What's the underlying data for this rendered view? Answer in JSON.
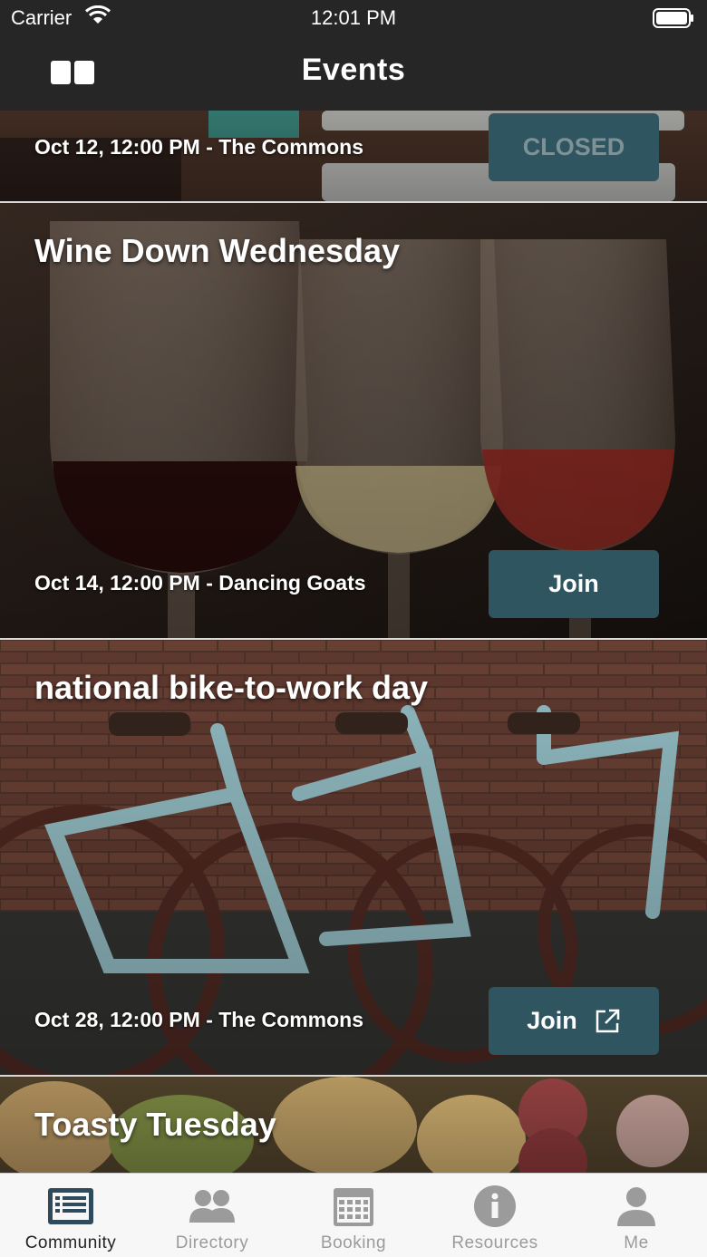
{
  "status_bar": {
    "carrier": "Carrier",
    "time": "12:01 PM"
  },
  "nav": {
    "title": "Events",
    "menu_icon": "book-icon"
  },
  "events": [
    {
      "title": "",
      "meta": "Oct 12, 12:00 PM - The Commons",
      "button": "CLOSED",
      "button_state": "closed"
    },
    {
      "title": "Wine Down Wednesday",
      "meta": "Oct 14, 12:00 PM - Dancing Goats",
      "button": "Join",
      "button_state": "open"
    },
    {
      "title": "national bike-to-work day",
      "meta": "Oct 28, 12:00 PM - The Commons",
      "button": "Join",
      "button_state": "external"
    },
    {
      "title": "Toasty Tuesday",
      "meta": "",
      "button": "",
      "button_state": ""
    }
  ],
  "tabs": [
    {
      "label": "Community",
      "icon": "news-list-icon",
      "active": true
    },
    {
      "label": "Directory",
      "icon": "people-icon",
      "active": false
    },
    {
      "label": "Booking",
      "icon": "calendar-icon",
      "active": false
    },
    {
      "label": "Resources",
      "icon": "info-icon",
      "active": false
    },
    {
      "label": "Me",
      "icon": "person-icon",
      "active": false
    }
  ],
  "colors": {
    "accent": "#2e5560",
    "bar": "#262626",
    "tab_active": "#2e4a5c",
    "tab_inactive": "#9b9b9b"
  }
}
